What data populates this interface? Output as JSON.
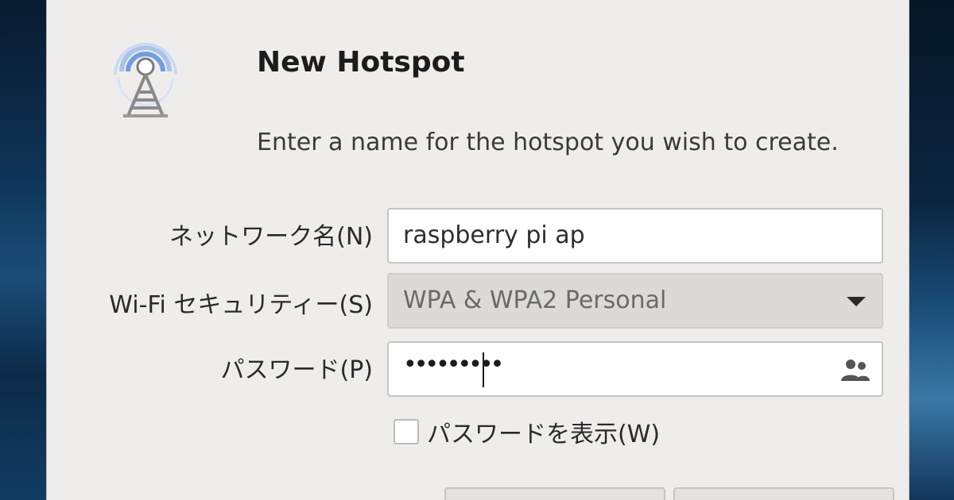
{
  "dialog": {
    "icon": "hotspot-tower-icon",
    "title": "New Hotspot",
    "subtitle": "Enter a name for the hotspot you wish to create."
  },
  "form": {
    "network_name_label": "ネットワーク名(N)",
    "network_name_value": "raspberry pi ap",
    "security_label": "Wi-Fi セキュリティー(S)",
    "security_value": "WPA & WPA2 Personal",
    "security_dropdown_icon": "chevron-down-icon",
    "password_label": "パスワード(P)",
    "password_value": "•••••••••",
    "password_icon": "people-icon",
    "show_password_label": "パスワードを表示(W)",
    "show_password_checked": false
  },
  "colors": {
    "dialog_bg": "#efedec",
    "icon_blue": "#5b8fd6"
  }
}
